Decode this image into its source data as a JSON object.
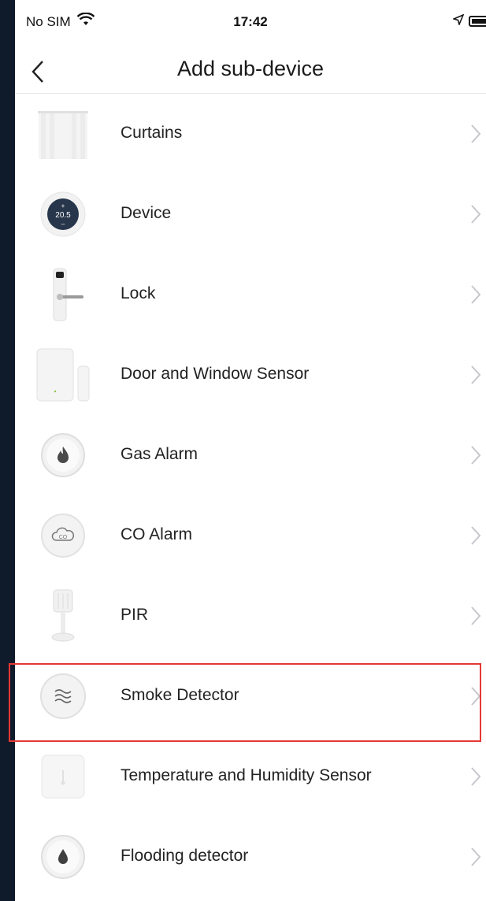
{
  "status_bar": {
    "carrier": "No SIM",
    "time": "17:42",
    "icons": [
      "wifi-icon",
      "location-arrow-icon",
      "battery-icon"
    ]
  },
  "nav": {
    "title": "Add sub-device",
    "back_icon": "chevron-left-icon"
  },
  "devices": [
    {
      "label": "Curtains",
      "icon": "curtains-icon"
    },
    {
      "label": "Device",
      "icon": "thermostat-icon",
      "icon_text": "20.5"
    },
    {
      "label": "Lock",
      "icon": "door-lock-icon"
    },
    {
      "label": "Door and Window Sensor",
      "icon": "door-window-sensor-icon"
    },
    {
      "label": "Gas Alarm",
      "icon": "gas-alarm-icon"
    },
    {
      "label": "CO Alarm",
      "icon": "co-alarm-icon"
    },
    {
      "label": "PIR",
      "icon": "pir-sensor-icon"
    },
    {
      "label": "Smoke Detector",
      "icon": "smoke-detector-icon",
      "highlighted": true
    },
    {
      "label": "Temperature and Humidity Sensor",
      "icon": "temp-humidity-sensor-icon"
    },
    {
      "label": "Flooding detector",
      "icon": "flood-detector-icon"
    }
  ],
  "colors": {
    "highlight": "#e53935",
    "background": "#0f1a2b",
    "chevron": "#c7c7cc"
  }
}
